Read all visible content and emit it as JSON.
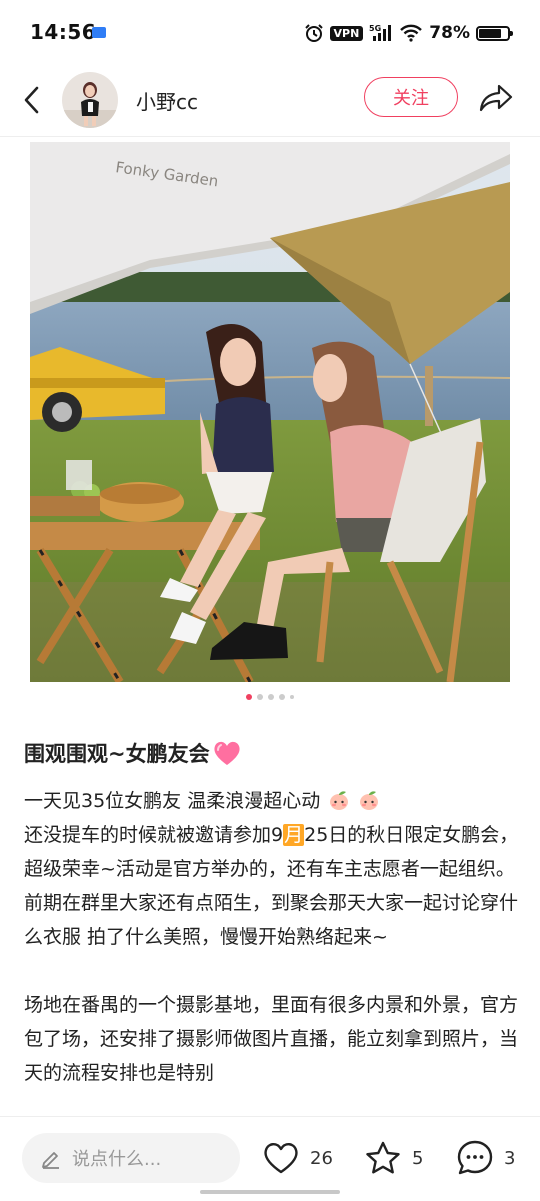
{
  "status_bar": {
    "time": "14:56",
    "network": "5G",
    "vpn_label": "VPN",
    "battery_percent": "78%",
    "battery_level": 0.78
  },
  "header": {
    "author_name": "小野cc",
    "follow_label": "关注"
  },
  "photo": {
    "tent_print": "Fonky Garden",
    "page_index": 1,
    "page_count": 5
  },
  "post": {
    "title": "围观围观~女鹏友会",
    "title_emoji": "pink-heart",
    "para1_line1": "一天见35位女鹏友 温柔浪漫超心动",
    "para1_rest_pre": "还没提车的时候就被邀请参加9",
    "para1_month": "月",
    "para1_rest_post": "25日的秋日限定女鹏会，超级荣幸~活动是官方举办的，还有车主志愿者一起组织。前期在群里大家还有点陌生，到聚会那天大家一起讨论穿什么衣服 拍了什么美照，慢慢开始熟络起来~",
    "para2": "场地在番禺的一个摄影基地，里面有很多内景和外景，官方包了场，还安排了摄影师做图片直播，能立刻拿到照片，当天的流程安排也是特别"
  },
  "bottom_bar": {
    "comment_placeholder": "说点什么...",
    "like_count": "26",
    "collect_count": "5",
    "comment_count": "3"
  },
  "colors": {
    "accent": "#f04060"
  }
}
